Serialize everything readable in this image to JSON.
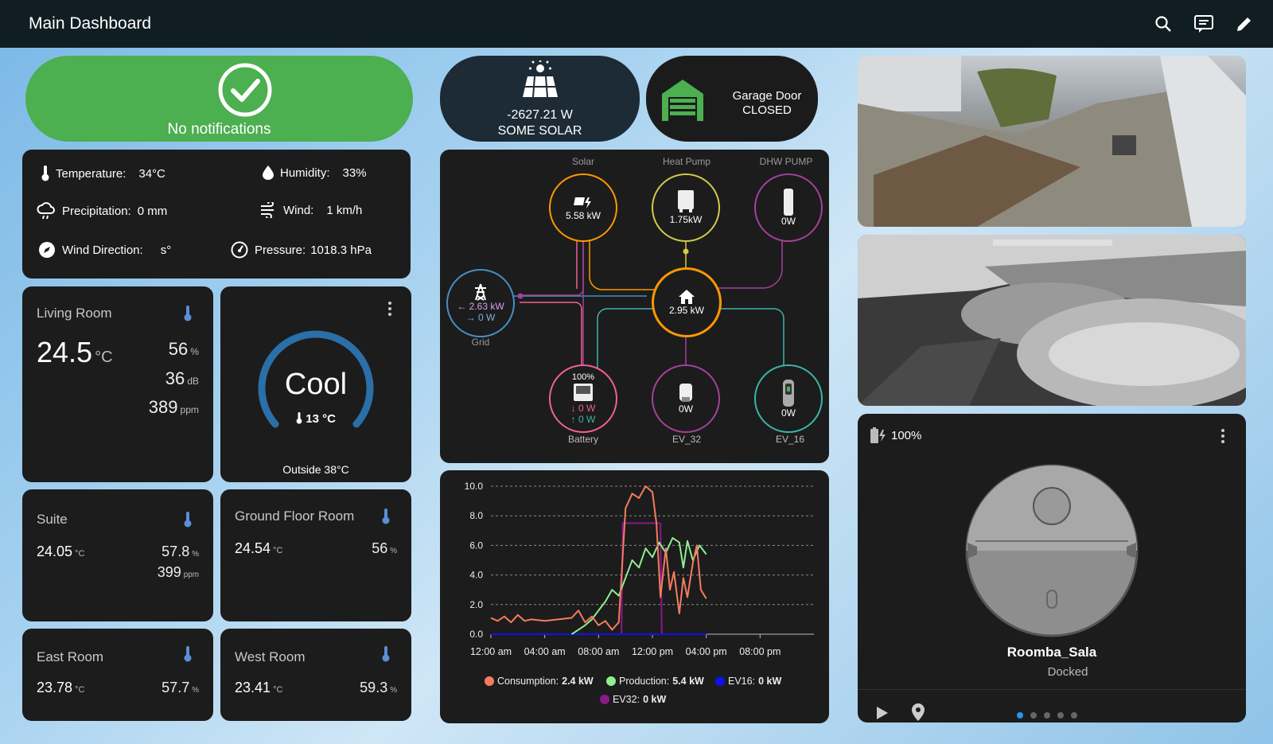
{
  "header": {
    "title": "Main Dashboard",
    "icons": [
      "search-icon",
      "chat-icon",
      "pencil-icon"
    ]
  },
  "notifications": {
    "label": "No notifications",
    "color": "#4caf50"
  },
  "solar": {
    "value": "-2627.21 W",
    "status": "SOME SOLAR"
  },
  "garage": {
    "label": "Garage Door",
    "state": "CLOSED"
  },
  "weather": {
    "temperature": {
      "label": "Temperature:",
      "value": "34°C"
    },
    "humidity": {
      "label": "Humidity:",
      "value": "33%"
    },
    "precipitation": {
      "label": "Precipitation:",
      "value": "0 mm"
    },
    "wind": {
      "label": "Wind:",
      "value": "1 km/h"
    },
    "wind_direction": {
      "label": "Wind Direction:",
      "value": "s°"
    },
    "pressure": {
      "label": "Pressure:",
      "value": "1018.3 hPa"
    }
  },
  "rooms": {
    "living": {
      "name": "Living Room",
      "temp": "24.5",
      "temp_unit": "°C",
      "humidity": "56",
      "humidity_unit": "%",
      "noise": "36",
      "noise_unit": "dB",
      "co2": "389",
      "co2_unit": "ppm"
    },
    "suite": {
      "name": "Suite",
      "temp": "24.05",
      "temp_unit": "°C",
      "humidity": "57.8",
      "humidity_unit": "%",
      "co2": "399",
      "co2_unit": "ppm"
    },
    "ground": {
      "name": "Ground Floor Room",
      "temp": "24.54",
      "temp_unit": "°C",
      "humidity": "56",
      "humidity_unit": "%"
    },
    "east": {
      "name": "East Room",
      "temp": "23.78",
      "temp_unit": "°C",
      "humidity": "57.7",
      "humidity_unit": "%"
    },
    "west": {
      "name": "West Room",
      "temp": "23.41",
      "temp_unit": "°C",
      "humidity": "59.3",
      "humidity_unit": "%"
    }
  },
  "thermostat": {
    "mode": "Cool",
    "current": "13 °C",
    "outside": "Outside 38°C",
    "accent": "#2a6fa8"
  },
  "energy_flow": {
    "solar": {
      "label": "Solar",
      "value": "5.58 kW",
      "color": "#ff9800"
    },
    "heat_pump": {
      "label": "Heat Pump",
      "value": "1.75kW",
      "color": "#d4c94a"
    },
    "dhw_pump": {
      "label": "DHW PUMP",
      "value": "0W",
      "color": "#a5409c"
    },
    "grid": {
      "label": "Grid",
      "import": "← 2.63 kW",
      "export": "→ 0 W",
      "color": "#488fc2"
    },
    "home": {
      "value": "2.95 kW",
      "color": "#ff9800"
    },
    "battery": {
      "label": "Battery",
      "soc": "100%",
      "out": "↓ 0 W",
      "in": "↑ 0 W",
      "color": "#f06292"
    },
    "ev32": {
      "label": "EV_32",
      "value": "0W",
      "color": "#a5409c"
    },
    "ev16": {
      "label": "EV_16",
      "value": "0W",
      "color": "#3ab5a8"
    }
  },
  "chart_data": {
    "type": "line",
    "x_ticks": [
      "12:00 am",
      "04:00 am",
      "08:00 am",
      "12:00 pm",
      "04:00 pm",
      "08:00 pm"
    ],
    "y_ticks": [
      "0.0",
      "2.0",
      "4.0",
      "6.0",
      "8.0",
      "10.0"
    ],
    "ylim": [
      0,
      10
    ],
    "xlim": [
      0,
      24
    ],
    "series": [
      {
        "name": "Consumption:",
        "current": "2.4 kW",
        "color": "#f47c5f",
        "x": [
          0,
          0.5,
          1,
          1.5,
          2,
          2.5,
          3,
          4,
          5,
          6,
          6.5,
          7,
          7.5,
          8,
          8.5,
          9,
          9.5,
          10,
          10.5,
          11,
          11.5,
          12,
          12.3,
          12.6,
          13,
          13.3,
          13.6,
          14,
          14.3,
          14.6,
          15,
          15.3,
          15.6,
          16
        ],
        "values": [
          1.1,
          0.9,
          1.2,
          0.8,
          1.3,
          0.9,
          1.0,
          0.9,
          1.0,
          1.1,
          1.6,
          0.8,
          1.2,
          0.6,
          0.9,
          0.3,
          0.8,
          8.5,
          9.5,
          9.2,
          10.0,
          9.6,
          7.5,
          2.5,
          5.8,
          3.0,
          4.2,
          1.4,
          3.8,
          2.5,
          4.8,
          6.0,
          3.0,
          2.4
        ]
      },
      {
        "name": "Production:",
        "current": "5.4 kW",
        "color": "#90ee90",
        "x": [
          6,
          6.5,
          7,
          7.5,
          8,
          8.5,
          9,
          9.5,
          10,
          10.5,
          11,
          11.5,
          12,
          12.5,
          13,
          13.5,
          14,
          14.3,
          14.6,
          15,
          15.5,
          16
        ],
        "values": [
          0,
          0.3,
          0.6,
          1.0,
          1.6,
          2.2,
          3.0,
          2.6,
          3.8,
          5.0,
          4.5,
          5.8,
          5.2,
          6.2,
          5.5,
          6.5,
          6.2,
          4.5,
          6.3,
          5.0,
          6.0,
          5.4
        ]
      },
      {
        "name": "EV16:",
        "current": "0 kW",
        "color": "#1010ee",
        "x": [
          0,
          16
        ],
        "values": [
          0,
          0
        ]
      },
      {
        "name": "EV32:",
        "current": "0 kW",
        "color": "#8a1a8a",
        "x": [
          0,
          9.7,
          9.8,
          12.6,
          12.7,
          16
        ],
        "values": [
          0,
          0,
          7.5,
          7.5,
          0,
          0
        ]
      }
    ]
  },
  "vacuum": {
    "battery": "100%",
    "name": "Roomba_Sala",
    "status": "Docked"
  }
}
